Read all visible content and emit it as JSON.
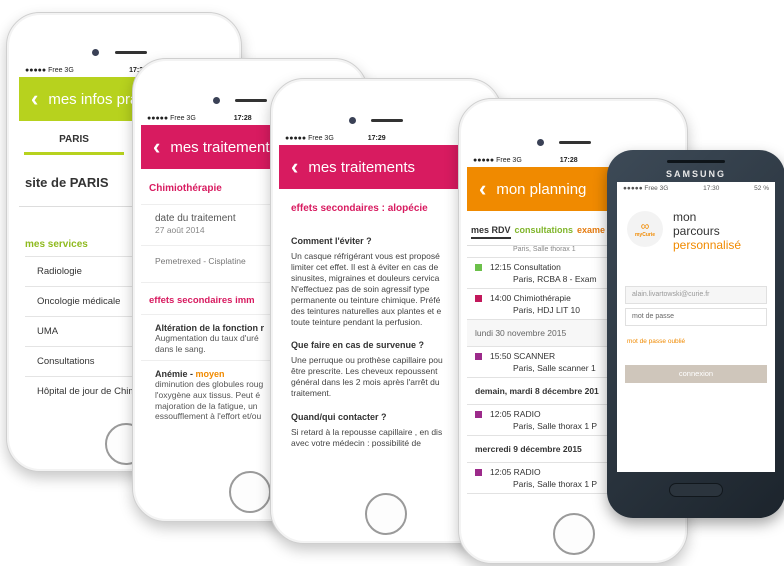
{
  "colors": {
    "green": "#b7d21e",
    "pink": "#d81b60",
    "orange": "#f08a00",
    "planning_green": "#6cc04a",
    "planning_purple": "#9c2a8a",
    "planning_magenta": "#c2185b"
  },
  "phone1": {
    "status": {
      "carrier": "●●●●● Free 3G",
      "time": "17:28"
    },
    "nav_title": "mes infos pra",
    "tab": "PARIS",
    "site": "site de PARIS",
    "services_title": "mes services",
    "services": [
      "Radiologie",
      "Oncologie médicale",
      "UMA",
      "Consultations",
      "Hôpital de jour de Chim"
    ]
  },
  "phone2": {
    "status": {
      "carrier": "●●●●● Free 3G",
      "time": "17:28"
    },
    "nav_title": "mes traitements",
    "treatment": "Chimiothérapie",
    "date_label": "date du traitement",
    "date_value": "27 août 2014",
    "drugs": "Pemetrexed - Cisplatine",
    "section": "effets secondaires imm",
    "effect1_title": "Altération de la fonction r",
    "effect1_text": [
      "Augmentation du taux d'uré",
      "dans le sang."
    ],
    "effect2_title": "Anémie - ",
    "effect2_level": "moyen",
    "effect2_text": [
      "diminution des globules roug",
      "l'oxygène aux tissus. Peut é",
      "majoration de la fatigue, un",
      "essoufflement à l'effort et/ou"
    ]
  },
  "phone3": {
    "status": {
      "carrier": "●●●●● Free 3G",
      "time": "17:29",
      "battery": "5"
    },
    "nav_title": "mes traitements",
    "title": "effets secondaires : alopécie",
    "q1": "Comment l'éviter ?",
    "a1": [
      "Un casque réfrigérant vous est proposé",
      "limiter cet effet. Il est à éviter en cas de",
      "sinusites, migraines et douleurs cervica",
      "N'effectuez pas de soin agressif type",
      "permanente ou teinture chimique. Préfé",
      "des teintures naturelles aux plantes et e",
      "toute teinture pendant la perfusion."
    ],
    "q2": "Que faire en cas de survenue ?",
    "a2": [
      "Une perruque ou prothèse capillaire pou",
      "être prescrite. Les cheveux repoussent",
      "général dans les 2 mois après l'arrêt du",
      "traitement."
    ],
    "q3": "Quand/qui contacter ?",
    "a3": [
      "Si retard à la repousse capillaire , en dis",
      "avec votre médecin : possibilité de"
    ]
  },
  "phone4": {
    "status": {
      "carrier": "●●●●● Free 3G",
      "time": "17:28"
    },
    "nav_title": "mon planning",
    "tabs": [
      "mes RDV",
      "consultations",
      "exame"
    ],
    "cut_row": "Paris, Salle thorax 1",
    "r1_time": "12:15 Consultation",
    "r1_place": "Paris, RCBA 8 - Exam",
    "r2_time": "14:00 Chimiothérapie",
    "r2_place": "Paris, HDJ LIT 10",
    "day1": "lundi 30 novembre 2015",
    "r3_time": "15:50 SCANNER",
    "r3_place": "Paris, Salle scanner 1",
    "day2": "demain, mardi 8 décembre 201",
    "r4_time": "12:05 RADIO",
    "r4_place": "Paris, Salle thorax 1 P",
    "day3": "mercredi 9 décembre 2015",
    "r5_time": "12:05 RADIO",
    "r5_place": "Paris, Salle thorax 1 P"
  },
  "samsung": {
    "brand": "SAMSUNG",
    "status": {
      "carrier": "●●●●● Free 3G",
      "time": "17:30",
      "battery": "52 %"
    },
    "logo_text": "myCurie",
    "title_line1": "mon",
    "title_line2": "parcours",
    "title_line3": "personnalisé",
    "email_value": "alain.livartowski@curie.fr",
    "password_placeholder": "mot de passe",
    "forgot": "mot de passe oublié",
    "login": "connexion"
  }
}
